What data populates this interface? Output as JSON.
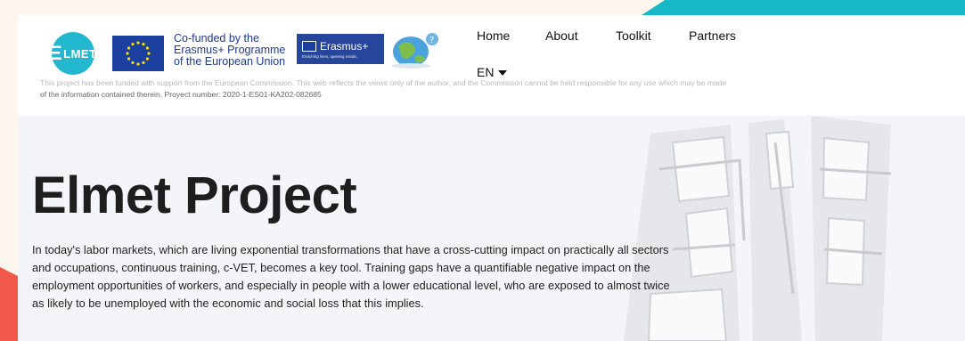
{
  "header": {
    "logo_text": "LMET",
    "eu_text_line1": "Co-funded by the",
    "eu_text_line2": "Erasmus+ Programme",
    "eu_text_line3": "of the European Union",
    "erasmus_text": "Erasmus+",
    "erasmus_sub": "Enriching lives, opening minds."
  },
  "nav": {
    "items": [
      {
        "label": "Home"
      },
      {
        "label": "About"
      },
      {
        "label": "Toolkit"
      },
      {
        "label": "Partners"
      }
    ],
    "language": "EN"
  },
  "disclaimer": {
    "part1": "This project has been funded with support from the European Commission. This web reflects the views only of the author, and the Commission cannot be held responsible for any use which may be made",
    "part2": "of the information contained therein. Proyect number: 2020-1-ES01-KA202-082685"
  },
  "hero": {
    "title": "Elmet Project",
    "text": "In today's labor markets, which are living exponential transformations that have a cross-cutting impact on practically all sectors and occupations, continuous training, c-VET, becomes a key tool. Training gaps have a quantifiable negative impact on the employment opportunities of workers, and especially in people with a lower educational level, who are exposed to almost twice as likely to be unemployed with the economic and social loss that this implies."
  },
  "colors": {
    "accent_teal": "#17b8c5",
    "accent_coral": "#f0584a",
    "eu_blue": "#1b3f9e",
    "elmet_cyan": "#23b8cf"
  },
  "icons": {
    "language_caret": "chevron-down-icon",
    "globe": "globe-icon"
  }
}
